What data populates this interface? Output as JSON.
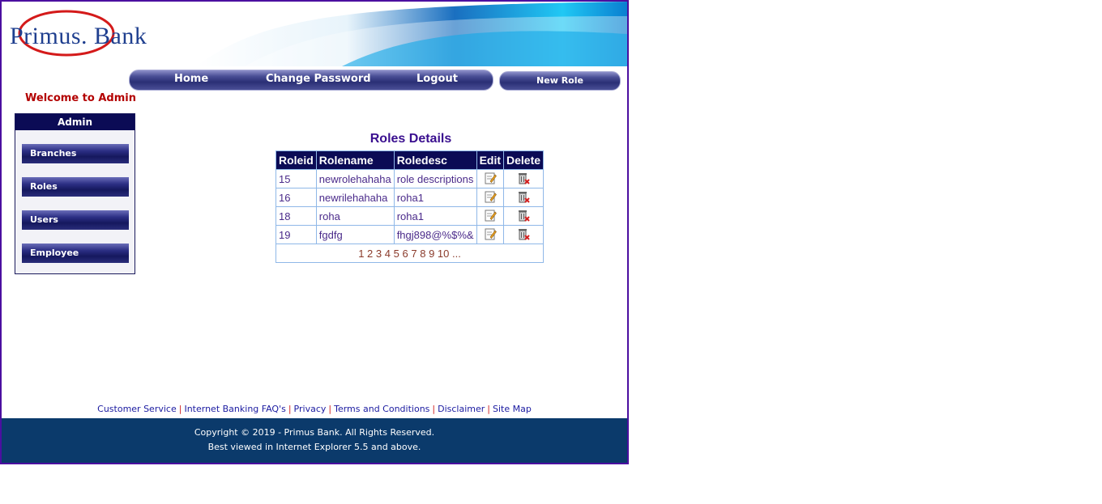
{
  "brand": {
    "name": "Primus. Bank"
  },
  "nav": {
    "home": "Home",
    "change_password": "Change Password",
    "logout": "Logout",
    "new_role": "New Role"
  },
  "welcome": "Welcome to Admin",
  "sidebar": {
    "title": "Admin",
    "items": [
      {
        "label": "Branches"
      },
      {
        "label": "Roles"
      },
      {
        "label": "Users"
      },
      {
        "label": "Employee"
      }
    ]
  },
  "roles": {
    "title": "Roles Details",
    "headers": [
      "Roleid",
      "Rolename",
      "Roledesc",
      "Edit",
      "Delete"
    ],
    "rows": [
      {
        "id": "15",
        "name": "newrolehahaha",
        "desc": "role descriptions"
      },
      {
        "id": "16",
        "name": "newrilehahaha",
        "desc": "roha1"
      },
      {
        "id": "18",
        "name": "roha",
        "desc": "roha1"
      },
      {
        "id": "19",
        "name": "fgdfg",
        "desc": "fhgj898@%$%&"
      }
    ],
    "pages": [
      "1",
      "2",
      "3",
      "4",
      "5",
      "6",
      "7",
      "8",
      "9",
      "10",
      "..."
    ]
  },
  "footer": {
    "links": [
      "Customer Service",
      "Internet Banking FAQ's",
      "Privacy",
      "Terms and Conditions",
      "Disclaimer",
      "Site Map"
    ],
    "copyright": "Copyright © 2019 - Primus Bank. All Rights Reserved.",
    "browser_note": "Best viewed in Internet Explorer 5.5 and above."
  },
  "colors": {
    "accent": "#0b0b55",
    "header_blue": "#1ab8f0",
    "footer_bg": "#0b3a6b",
    "welcome": "#b30000"
  },
  "icons": {
    "edit": "edit-icon",
    "delete": "delete-icon"
  }
}
